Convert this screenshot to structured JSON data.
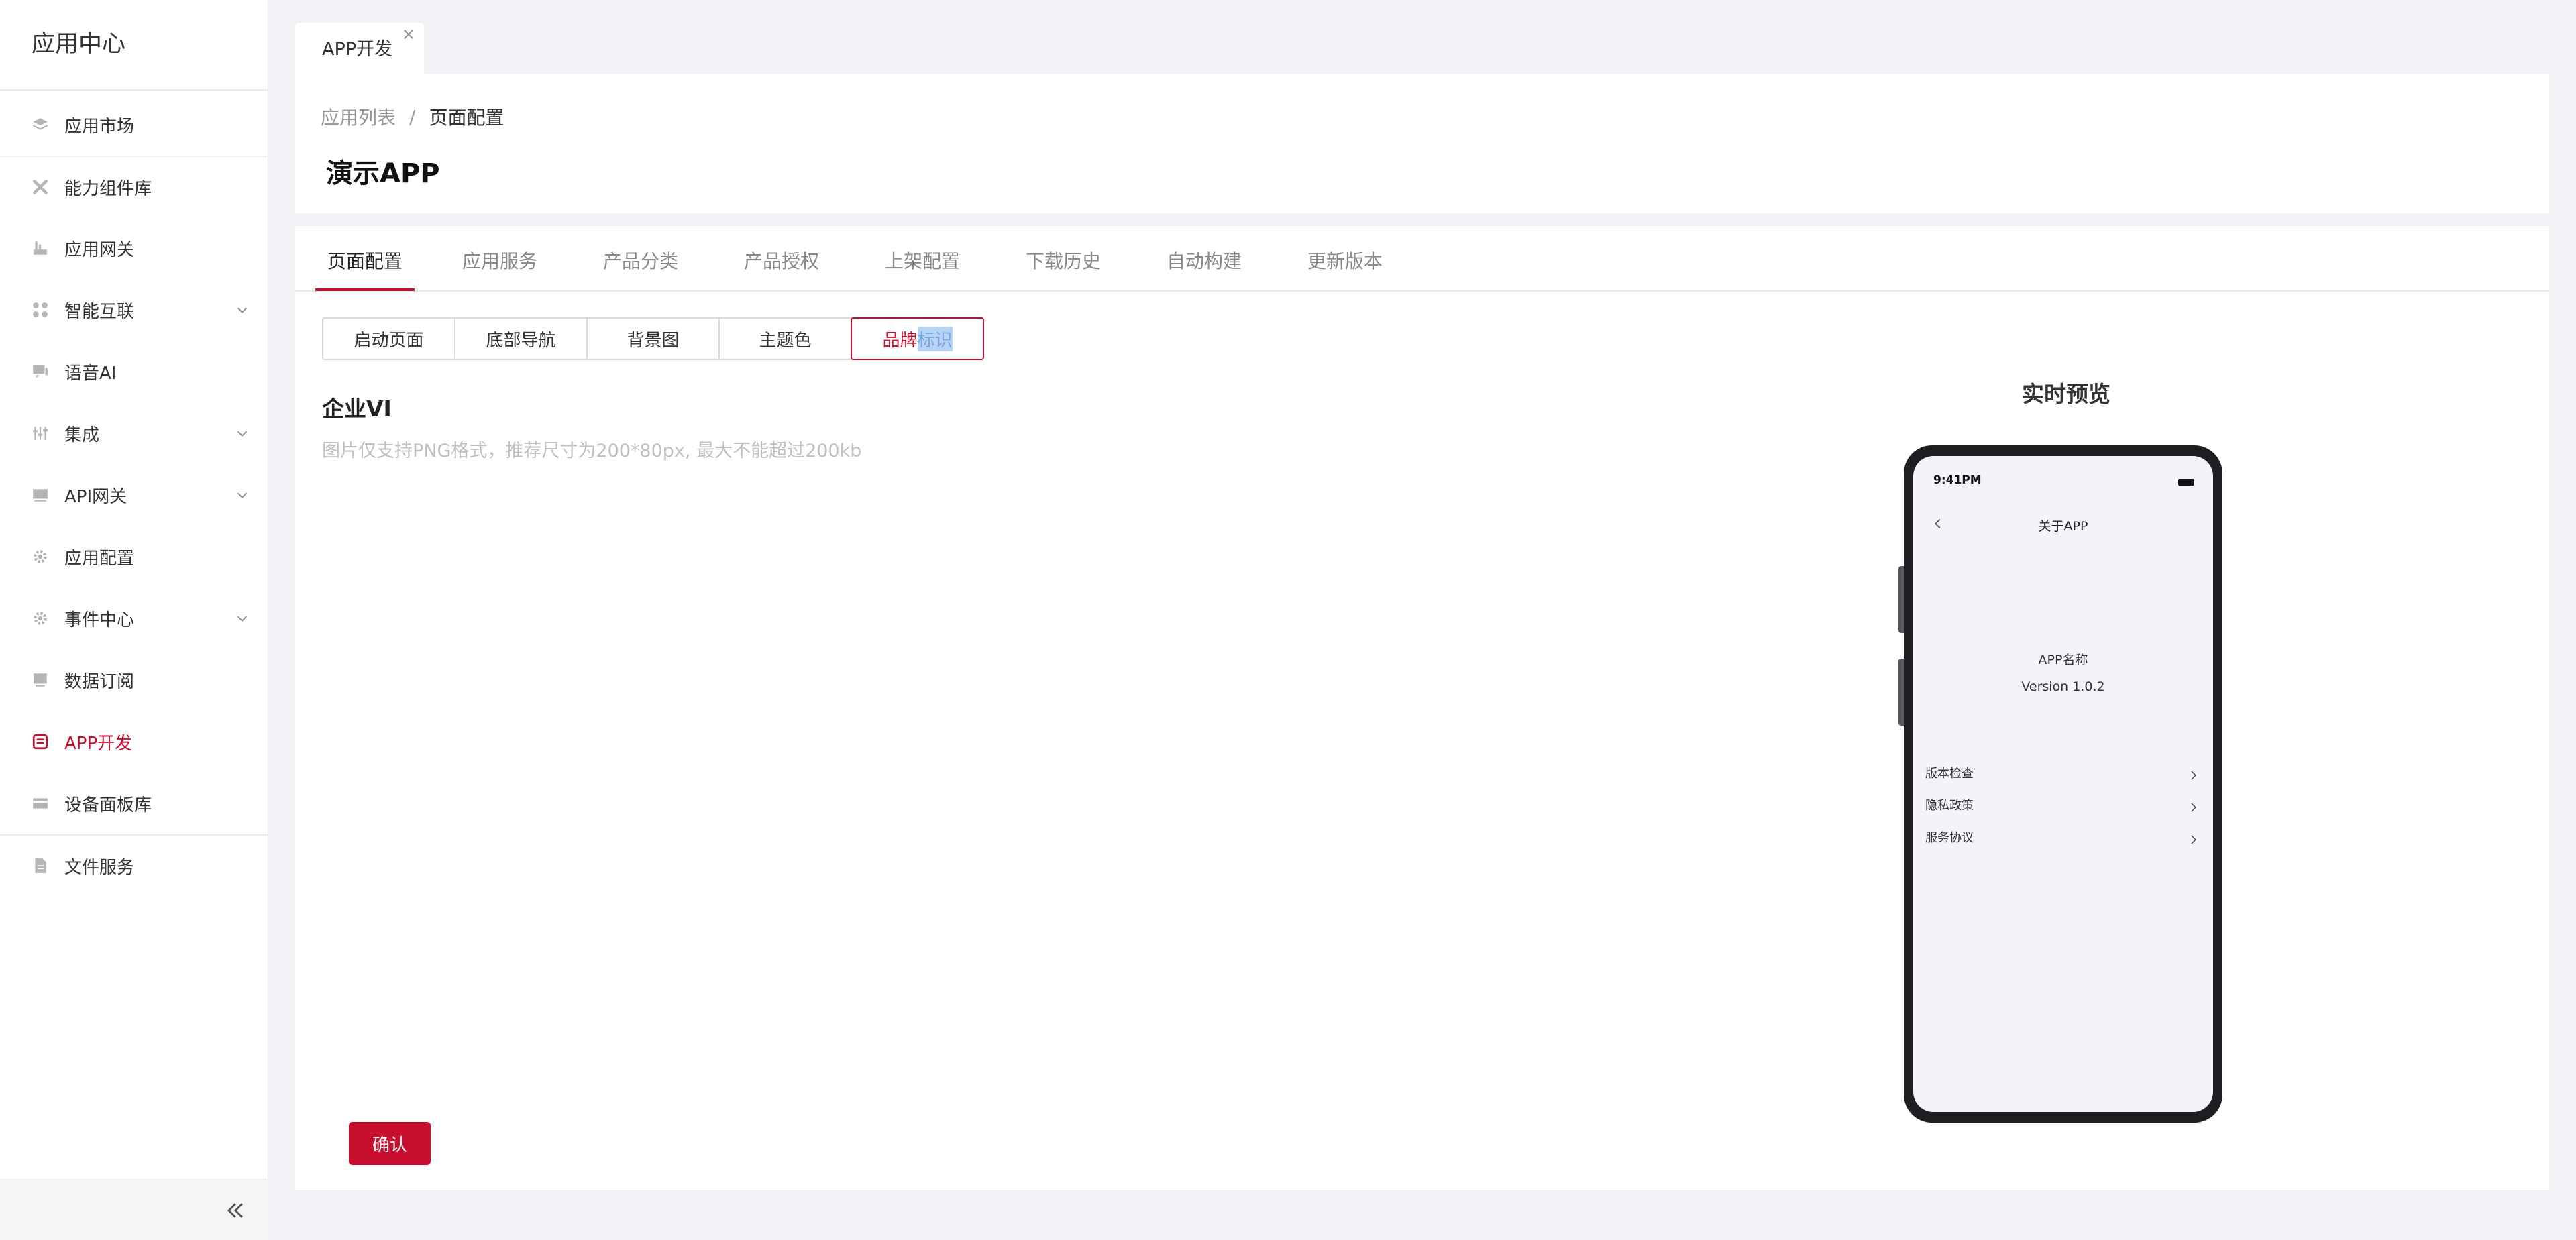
{
  "sidebar": {
    "title": "应用中心",
    "items": [
      {
        "label": "应用市场",
        "icon": "layers-icon"
      },
      {
        "label": "能力组件库",
        "icon": "tools-icon"
      },
      {
        "label": "应用网关",
        "icon": "gateway-icon"
      },
      {
        "label": "智能互联",
        "icon": "grid-icon",
        "expandable": true
      },
      {
        "label": "语音AI",
        "icon": "chat-icon"
      },
      {
        "label": "集成",
        "icon": "sliders-icon",
        "expandable": true
      },
      {
        "label": "API网关",
        "icon": "monitor-icon",
        "expandable": true
      },
      {
        "label": "应用配置",
        "icon": "gear-icon"
      },
      {
        "label": "事件中心",
        "icon": "gear-icon",
        "expandable": true
      },
      {
        "label": "数据订阅",
        "icon": "screen-icon"
      },
      {
        "label": "APP开发",
        "icon": "app-icon",
        "active": true
      },
      {
        "label": "设备面板库",
        "icon": "card-icon"
      },
      {
        "label": "文件服务",
        "icon": "file-icon"
      }
    ]
  },
  "top_tab": {
    "label": "APP开发"
  },
  "header": {
    "breadcrumb": [
      "应用列表",
      "页面配置"
    ],
    "breadcrumb_sep": "/",
    "title": "演示APP"
  },
  "tabs": [
    "页面配置",
    "应用服务",
    "产品分类",
    "产品授权",
    "上架配置",
    "下载历史",
    "自动构建",
    "更新版本"
  ],
  "segments": [
    "启动页面",
    "底部导航",
    "背景图",
    "主题色"
  ],
  "active_segment": {
    "main": "品牌",
    "highlight": "标识"
  },
  "section": {
    "title": "企业VI",
    "hint": "图片仅支持PNG格式，推荐尺寸为200*80px, 最大不能超过200kb"
  },
  "confirm_label": "确认",
  "preview": {
    "title": "实时预览",
    "time": "9:41PM",
    "nav_title": "关于APP",
    "app_name": "APP名称",
    "version": "Version 1.0.2",
    "rows": [
      "版本检查",
      "隐私政策",
      "服务协议"
    ]
  },
  "colors": {
    "accent": "#c8102e",
    "background": "#f1f2f5",
    "phone_frame": "#1d1d22",
    "phone_screen": "#f3f3f9"
  }
}
